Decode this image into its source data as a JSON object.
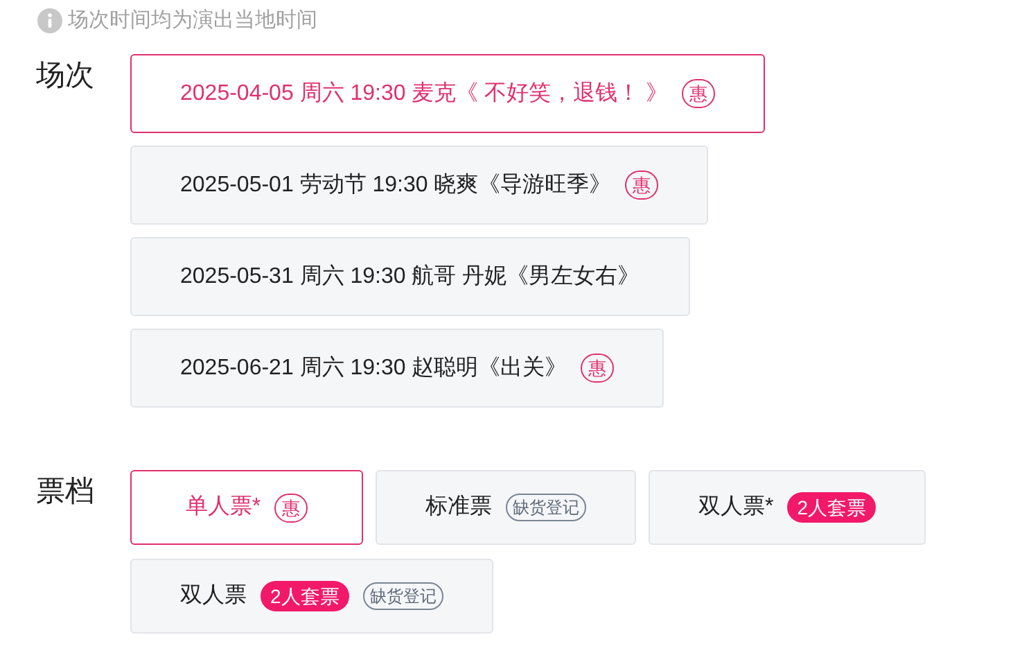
{
  "notice": {
    "text": "场次时间均为演出当地时间"
  },
  "sessions": {
    "label": "场次",
    "items": [
      {
        "text": "2025-04-05 周六 19:30 麦克《 不好笑，退钱！ 》",
        "selected": true,
        "tags": [
          {
            "kind": "discount",
            "text": "惠"
          }
        ]
      },
      {
        "text": "2025-05-01 劳动节 19:30 晓爽《导游旺季》",
        "selected": false,
        "tags": [
          {
            "kind": "discount",
            "text": "惠"
          }
        ]
      },
      {
        "text": "2025-05-31 周六 19:30 航哥 丹妮《男左女右》",
        "selected": false
      },
      {
        "text": "2025-06-21 周六 19:30 赵聪明《出关》",
        "selected": false,
        "tags": [
          {
            "kind": "discount",
            "text": "惠"
          }
        ]
      }
    ]
  },
  "tickets": {
    "label": "票档",
    "items": [
      {
        "text": "单人票*",
        "selected": true,
        "tags": [
          {
            "kind": "discount",
            "text": "惠"
          }
        ]
      },
      {
        "text": "标准票",
        "selected": false,
        "tags": [
          {
            "kind": "soldout",
            "text": "缺货登记"
          }
        ]
      },
      {
        "text": "双人票*",
        "selected": false,
        "tags": [
          {
            "kind": "bundle",
            "text": "2人套票"
          }
        ]
      },
      {
        "text": "双人票",
        "selected": false,
        "tags": [
          {
            "kind": "bundle",
            "text": "2人套票"
          },
          {
            "kind": "soldout",
            "text": "缺货登记"
          }
        ]
      }
    ]
  }
}
